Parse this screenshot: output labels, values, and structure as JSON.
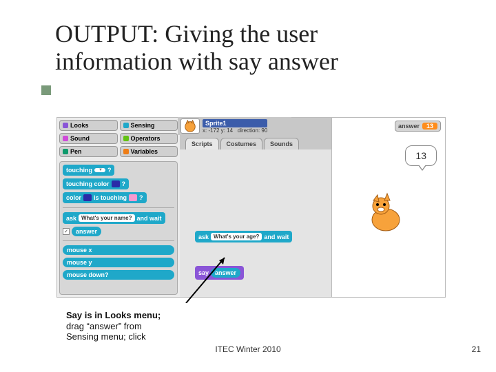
{
  "title_line1": "OUTPUT: Giving the user",
  "title_line2": "information with say answer",
  "palette": {
    "categories": [
      {
        "label": "Looks",
        "color": "#8a55d7"
      },
      {
        "label": "Sensing",
        "color": "#1fa8c9"
      },
      {
        "label": "Sound",
        "color": "#cf4ad9"
      },
      {
        "label": "Operators",
        "color": "#62c213"
      },
      {
        "label": "Pen",
        "color": "#0e9a6c"
      },
      {
        "label": "Variables",
        "color": "#ee7d16"
      }
    ],
    "blocks": {
      "touching_label": "touching",
      "touching_arg": "",
      "q": "?",
      "touching_color_label": "touching color",
      "color_touching_label_pre": "color",
      "color_touching_label_mid": "is touching",
      "ask_label": "ask",
      "ask_prompt": "What's your name?",
      "and_wait": "and wait",
      "answer": "answer",
      "mouse_x": "mouse x",
      "mouse_y": "mouse y",
      "mouse_down": "mouse down?"
    }
  },
  "sprite": {
    "name": "Sprite1",
    "pos": "x: -172  y: 14",
    "dir": "direction: 90"
  },
  "tabs": {
    "scripts": "Scripts",
    "costumes": "Costumes",
    "sounds": "Sounds"
  },
  "scripts": {
    "ask_label": "ask",
    "ask_prompt": "What's your age?",
    "and_wait": "and wait",
    "say_label": "say",
    "answer": "answer"
  },
  "stage": {
    "monitor_label": "answer",
    "monitor_value": "13",
    "speech": "13"
  },
  "caption_l1": "Say is in Looks menu;",
  "caption_l2": "drag “answer” from",
  "caption_l3": "Sensing menu; click",
  "footer": "ITEC Winter 2010",
  "page": "21"
}
